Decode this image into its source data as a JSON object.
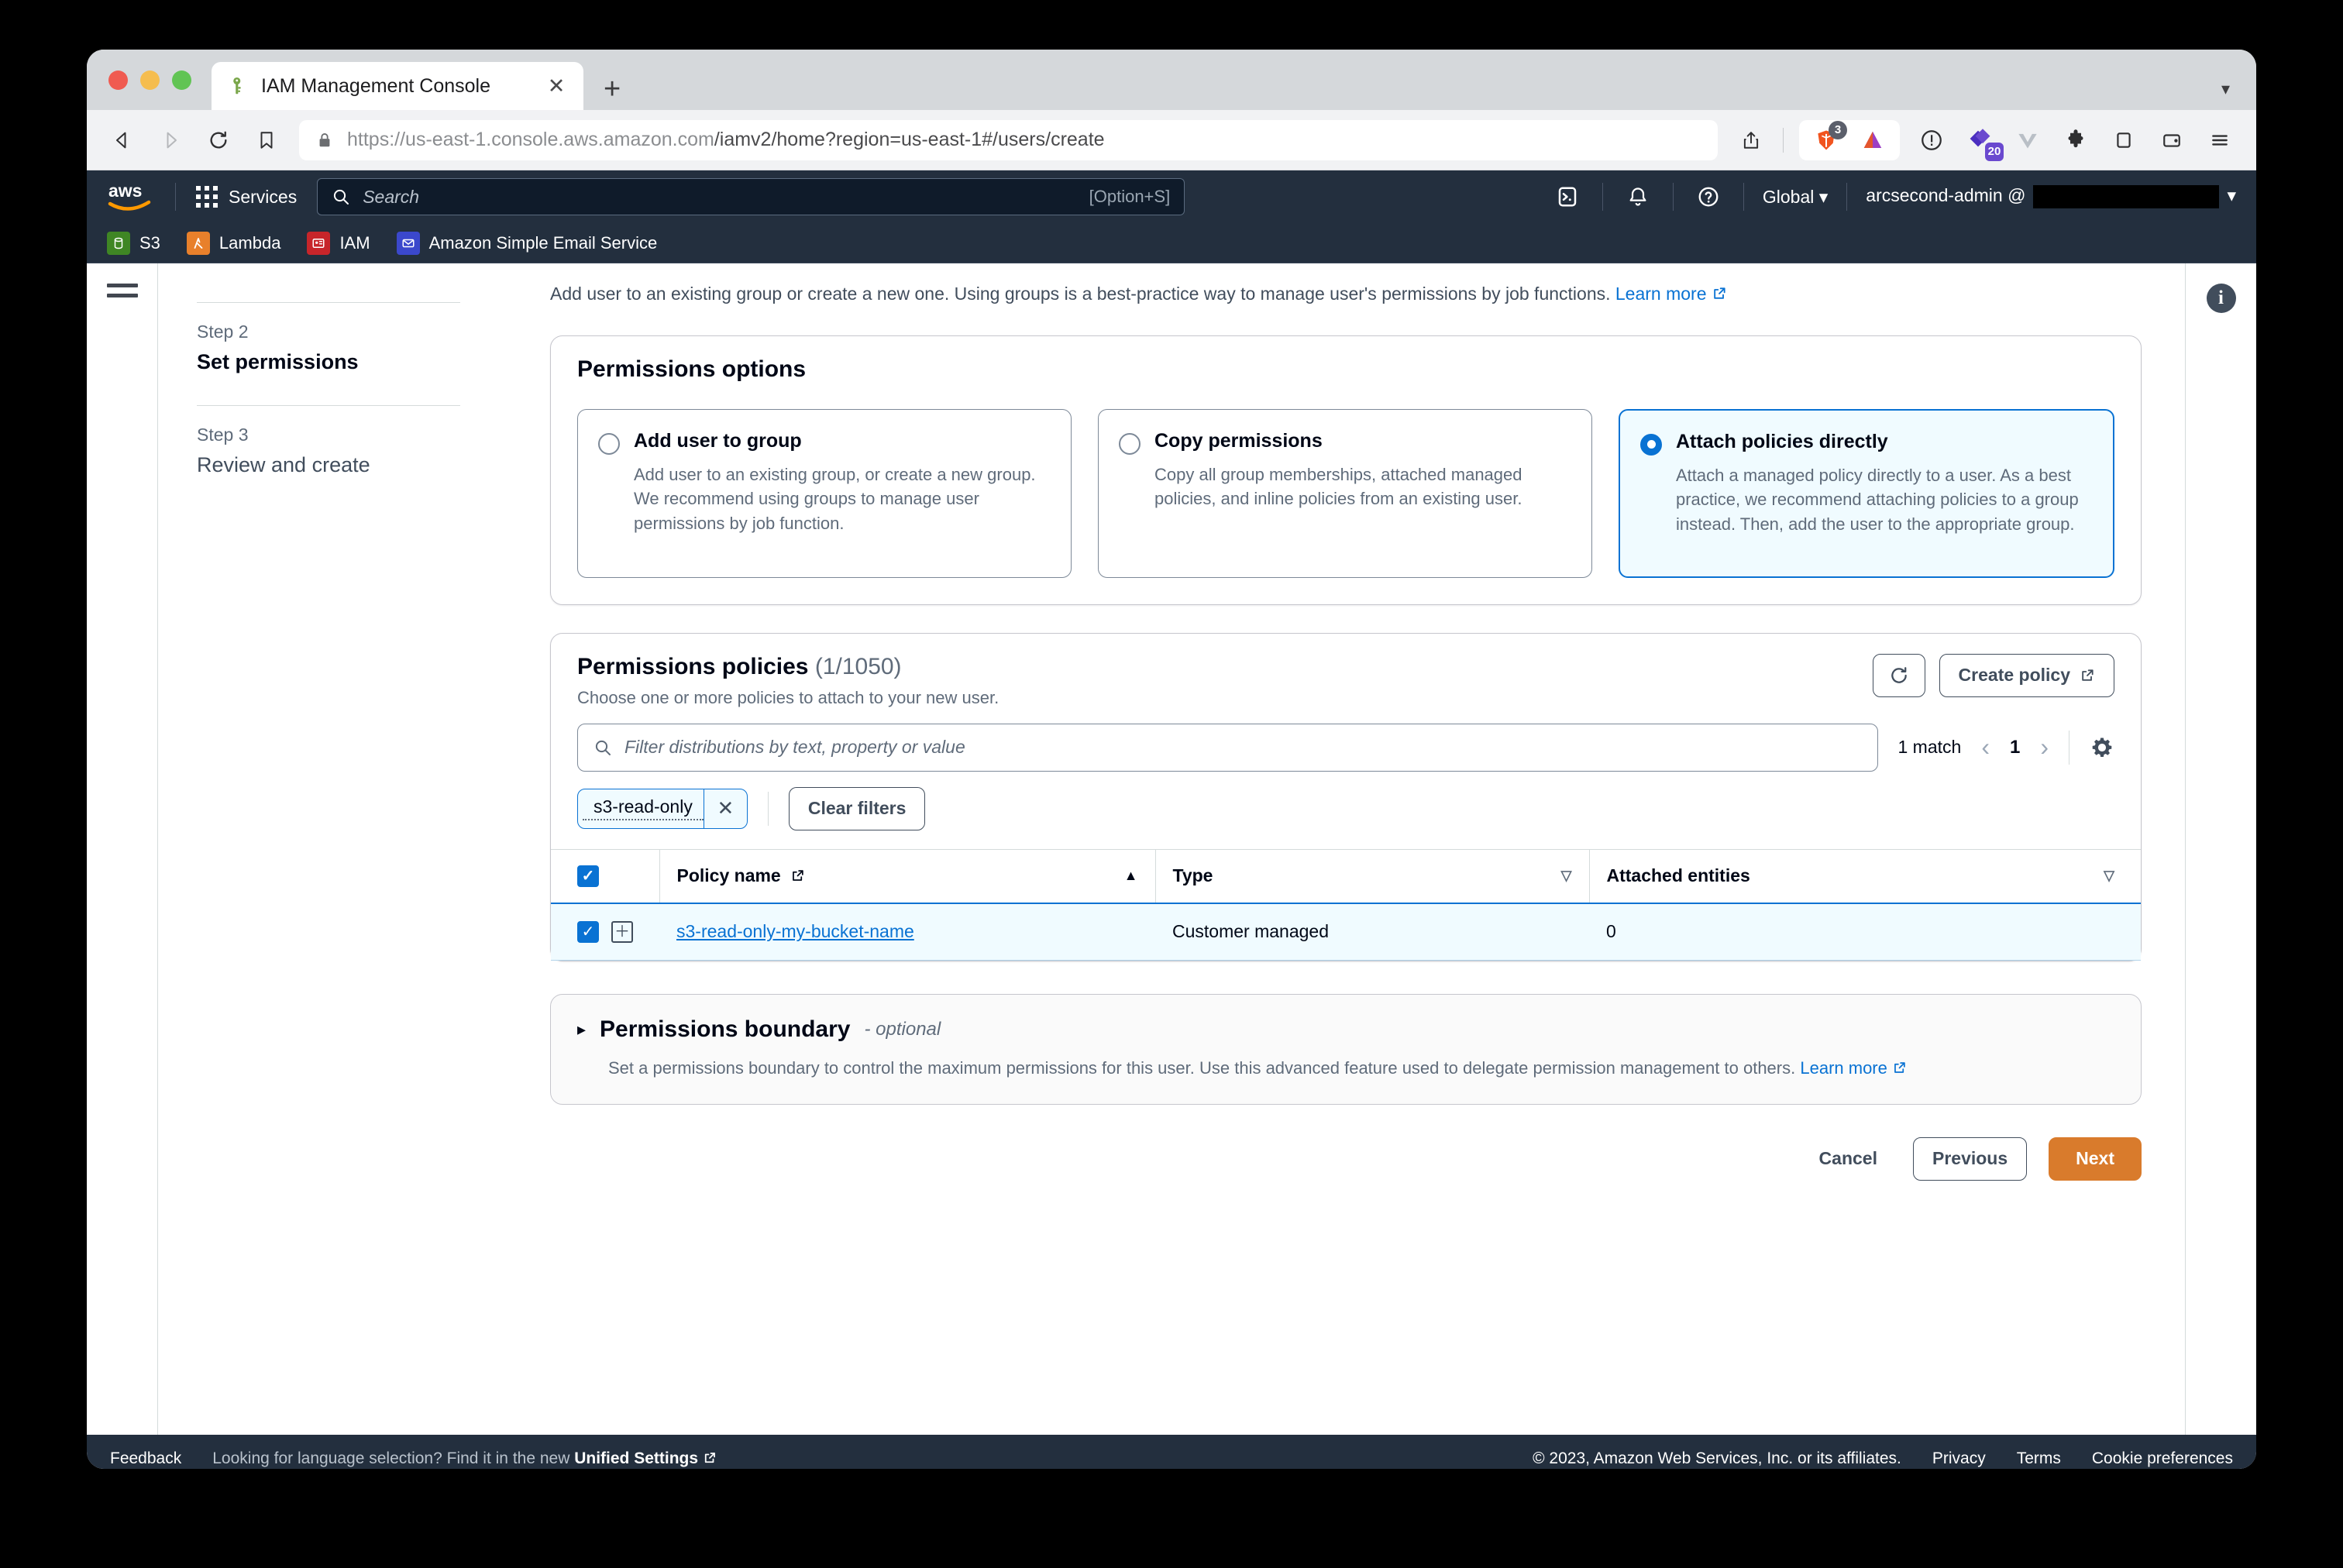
{
  "browser": {
    "tab": {
      "title": "IAM Management Console",
      "favicon": "key-icon",
      "close_label": "✕"
    },
    "new_tab_label": "+",
    "tabstrip_menu": "▾",
    "url": "https://us-east-1.console.aws.amazon.com/iamv2/home?region=us-east-1#/users/create",
    "url_scheme": "https://us-east-1.console.aws.amazon.com",
    "url_path": "/iamv2/home?region=us-east-1#/users/create",
    "extensions": {
      "brave_badge": "3",
      "purple_badge": "20"
    }
  },
  "aws_header": {
    "logo": "aws",
    "services_label": "Services",
    "search_placeholder": "Search",
    "search_shortcut": "[Option+S]",
    "region_label": "Global",
    "region_caret": "▾",
    "account_label": "arcsecond-admin @",
    "account_caret": "▾",
    "favorites": [
      {
        "label": "S3",
        "icon": "s3-icon",
        "color": "#3f8624"
      },
      {
        "label": "Lambda",
        "icon": "lambda-icon",
        "color": "#e8802b"
      },
      {
        "label": "IAM",
        "icon": "iam-icon",
        "color": "#c7252a"
      },
      {
        "label": "Amazon Simple Email Service",
        "icon": "ses-icon",
        "color": "#3b48cc"
      }
    ]
  },
  "wizard": {
    "steps": [
      {
        "number": "Step 2",
        "title": "Set permissions",
        "active": true
      },
      {
        "number": "Step 3",
        "title": "Review and create",
        "active": false
      }
    ]
  },
  "lede": {
    "text": "Add user to an existing group or create a new one. Using groups is a best-practice way to manage user's permissions by job functions.",
    "link": "Learn more"
  },
  "permissions_options": {
    "title": "Permissions options",
    "options": [
      {
        "label": "Add user to group",
        "description": "Add user to an existing group, or create a new group. We recommend using groups to manage user permissions by job function.",
        "selected": false
      },
      {
        "label": "Copy permissions",
        "description": "Copy all group memberships, attached managed policies, and inline policies from an existing user.",
        "selected": false
      },
      {
        "label": "Attach policies directly",
        "description": "Attach a managed policy directly to a user. As a best practice, we recommend attaching policies to a group instead. Then, add the user to the appropriate group.",
        "selected": true
      }
    ]
  },
  "permissions_policies": {
    "title": "Permissions policies",
    "counter": "(1/1050)",
    "description": "Choose one or more policies to attach to your new user.",
    "refresh_label": "↻",
    "create_policy_label": "Create policy",
    "filter_placeholder": "Filter distributions by text, property or value",
    "filter_value": "",
    "match_count": "1 match",
    "page_number": "1",
    "prev_arrow": "‹",
    "next_arrow": "›",
    "settings_icon": "gear-icon",
    "token": {
      "label": "s3-read-only",
      "dismiss": "✕"
    },
    "clear_filters_label": "Clear filters",
    "columns": [
      {
        "label": "Policy name",
        "external": true,
        "sort": "▲"
      },
      {
        "label": "Type",
        "filter": "▽"
      },
      {
        "label": "Attached entities",
        "filter": "▽"
      }
    ],
    "select_all_checked": true,
    "rows": [
      {
        "checked": true,
        "expander": "＋",
        "policy_name": "s3-read-only-my-bucket-name",
        "type": "Customer managed",
        "attached_entities": "0"
      }
    ]
  },
  "permissions_boundary": {
    "caret": "▸",
    "title": "Permissions boundary",
    "optional": "- optional",
    "description": "Set a permissions boundary to control the maximum permissions for this user. Use this advanced feature used to delegate permission management to others.",
    "link": "Learn more"
  },
  "actions": {
    "cancel": "Cancel",
    "previous": "Previous",
    "next": "Next",
    "next_color": "#d97b2c"
  },
  "footer": {
    "feedback": "Feedback",
    "language_prompt": "Looking for language selection? Find it in the new",
    "unified_settings": "Unified Settings",
    "copyright": "© 2023, Amazon Web Services, Inc. or its affiliates.",
    "privacy": "Privacy",
    "terms": "Terms",
    "cookies": "Cookie preferences"
  }
}
